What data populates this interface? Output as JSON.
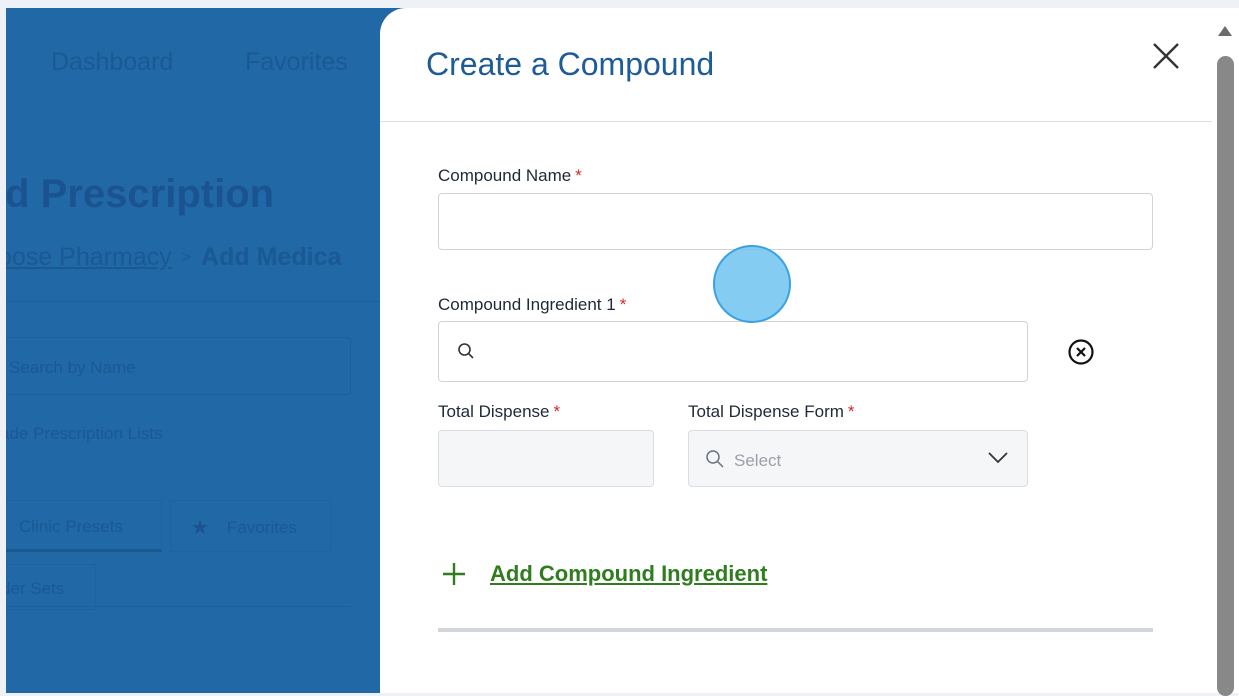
{
  "background_app": {
    "nav": {
      "dashboard": "Dashboard",
      "favorites": "Favorites"
    },
    "heading": "ld Prescription",
    "breadcrumb": {
      "link": "oose Pharmacy",
      "separator": ">",
      "current": "Add Medica"
    },
    "search_placeholder": "Search by Name",
    "lists_label": "ade Prescription Lists",
    "tabs": {
      "clinic": "Clinic Presets",
      "favorites": "Favorites",
      "order_sets": "der Sets"
    }
  },
  "modal": {
    "title": "Create a Compound",
    "compound_name": {
      "label": "Compound Name",
      "required_mark": "*",
      "value": ""
    },
    "ingredient": {
      "label": "Compound Ingredient 1",
      "required_mark": "*",
      "value": ""
    },
    "total_dispense": {
      "label": "Total Dispense",
      "required_mark": "*",
      "value": ""
    },
    "total_dispense_form": {
      "label": "Total Dispense Form",
      "required_mark": "*",
      "placeholder": "Select"
    },
    "add_ingredient_label": "Add Compound Ingredient"
  },
  "colors": {
    "accent_blue": "#1d5c96",
    "add_green": "#2f7d1f",
    "required_red": "#dc2626",
    "overlay_blue": "#2168a6"
  },
  "icons": {
    "close": "close-icon",
    "search": "search-icon",
    "remove": "circle-x-icon",
    "chevron": "chevron-down-icon",
    "plus": "plus-icon",
    "star": "star-icon"
  }
}
